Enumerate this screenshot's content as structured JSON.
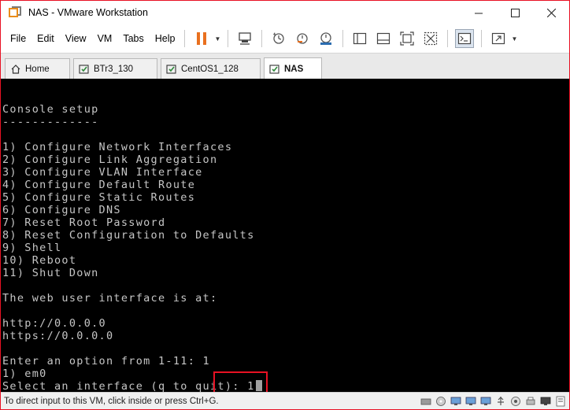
{
  "window": {
    "title": "NAS - VMware Workstation",
    "accent_border": "#e81123"
  },
  "menu": [
    "File",
    "Edit",
    "View",
    "VM",
    "Tabs",
    "Help"
  ],
  "toolbar_icons": [
    "pause-icon",
    "send-ctrl-alt-del-icon",
    "snapshot-icon",
    "revert-snapshot-icon",
    "snapshot-manager-icon",
    "library-icon",
    "thumbnail-bar-icon",
    "full-screen-icon",
    "unity-icon",
    "console-view-icon",
    "stretch-icon"
  ],
  "tabs": [
    {
      "label": "Home",
      "icon": "home-icon"
    },
    {
      "label": "BTr3_130",
      "icon": "vm-icon"
    },
    {
      "label": "CentOS1_128",
      "icon": "vm-icon"
    },
    {
      "label": "NAS",
      "icon": "vm-icon",
      "active": true
    }
  ],
  "console": {
    "lines": [
      "Console setup",
      "-------------",
      "",
      "1) Configure Network Interfaces",
      "2) Configure Link Aggregation",
      "3) Configure VLAN Interface",
      "4) Configure Default Route",
      "5) Configure Static Routes",
      "6) Configure DNS",
      "7) Reset Root Password",
      "8) Reset Configuration to Defaults",
      "9) Shell",
      "10) Reboot",
      "11) Shut Down",
      "",
      "The web user interface is at:",
      "",
      "http://0.0.0.0",
      "https://0.0.0.0",
      "",
      "Enter an option from 1-11: 1",
      "1) em0",
      "Select an interface (q to quit): 1"
    ]
  },
  "status": {
    "text": "To direct input to this VM, click inside or press Ctrl+G."
  }
}
